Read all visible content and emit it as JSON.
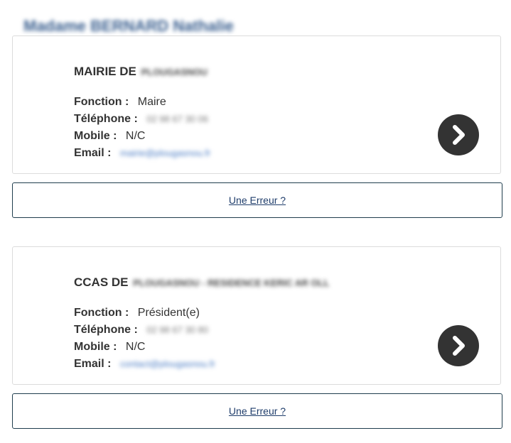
{
  "header": {
    "person_name": "Madame BERNARD Nathalie"
  },
  "cards": [
    {
      "title_prefix": "MAIRIE DE",
      "title_blurred": "PLOUGASNOU",
      "fonction_label": "Fonction :",
      "fonction_value": "Maire",
      "telephone_label": "Téléphone :",
      "telephone_value": "02 98 67 30 06",
      "mobile_label": "Mobile :",
      "mobile_value": "N/C",
      "email_label": "Email :",
      "email_value": "mairie@plougasnou.fr",
      "error_link": "Une Erreur ?"
    },
    {
      "title_prefix": "CCAS DE",
      "title_blurred": "PLOUGASNOU - RESIDENCE KERIC AR OLL",
      "fonction_label": "Fonction :",
      "fonction_value": "Président(e)",
      "telephone_label": "Téléphone :",
      "telephone_value": "02 98 67 30 80",
      "mobile_label": "Mobile :",
      "mobile_value": "N/C",
      "email_label": "Email :",
      "email_value": "contact@plougasnou.fr",
      "error_link": "Une Erreur ?"
    }
  ],
  "icons": {
    "details": "chevron-right-icon"
  },
  "colors": {
    "button_bg": "#333333",
    "link": "#1f3d6b",
    "name": "#3a5f8f"
  }
}
